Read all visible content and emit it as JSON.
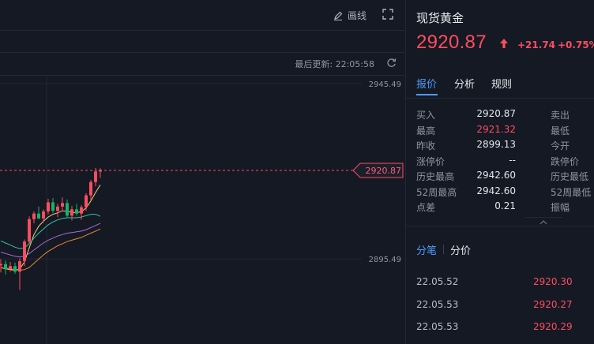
{
  "toolbar": {
    "draw_label": "画线",
    "draw_icon": "pen-icon",
    "fullscreen_icon": "fullscreen-icon"
  },
  "chart": {
    "last_update_label": "最后更新: 22:05:58",
    "refresh_icon": "refresh-icon",
    "axis_labels": [
      "2945.49",
      "2895.49"
    ],
    "current_price_tag": "2920.87"
  },
  "chart_data": {
    "type": "candlestick",
    "title": "",
    "y_ticks": [
      2945.49,
      2895.49
    ],
    "last_price": 2920.87,
    "colors": {
      "up": "#ff4d60",
      "down": "#17b26a"
    },
    "candles": [
      {
        "o": 2893.6,
        "h": 2895.4,
        "l": 2891.6,
        "c": 2894.0
      },
      {
        "o": 2894.0,
        "h": 2895.0,
        "l": 2891.0,
        "c": 2892.5
      },
      {
        "o": 2892.5,
        "h": 2894.6,
        "l": 2891.8,
        "c": 2893.4
      },
      {
        "o": 2893.4,
        "h": 2894.4,
        "l": 2891.2,
        "c": 2891.8
      },
      {
        "o": 2891.8,
        "h": 2895.6,
        "l": 2886.6,
        "c": 2894.8
      },
      {
        "o": 2894.8,
        "h": 2901.0,
        "l": 2893.4,
        "c": 2900.4
      },
      {
        "o": 2900.4,
        "h": 2907.6,
        "l": 2899.6,
        "c": 2906.8
      },
      {
        "o": 2906.8,
        "h": 2909.0,
        "l": 2905.6,
        "c": 2908.4
      },
      {
        "o": 2908.4,
        "h": 2910.4,
        "l": 2906.8,
        "c": 2907.0
      },
      {
        "o": 2907.0,
        "h": 2909.6,
        "l": 2905.8,
        "c": 2909.0
      },
      {
        "o": 2909.0,
        "h": 2912.6,
        "l": 2908.2,
        "c": 2911.6
      },
      {
        "o": 2911.6,
        "h": 2912.8,
        "l": 2908.6,
        "c": 2909.2
      },
      {
        "o": 2909.2,
        "h": 2911.2,
        "l": 2907.4,
        "c": 2910.4
      },
      {
        "o": 2910.4,
        "h": 2913.0,
        "l": 2909.0,
        "c": 2911.4
      },
      {
        "o": 2911.4,
        "h": 2912.4,
        "l": 2907.2,
        "c": 2907.8
      },
      {
        "o": 2907.8,
        "h": 2910.6,
        "l": 2906.4,
        "c": 2909.6
      },
      {
        "o": 2909.6,
        "h": 2911.2,
        "l": 2907.8,
        "c": 2908.4
      },
      {
        "o": 2908.4,
        "h": 2910.8,
        "l": 2906.6,
        "c": 2910.2
      },
      {
        "o": 2910.2,
        "h": 2914.2,
        "l": 2909.2,
        "c": 2913.6
      },
      {
        "o": 2913.6,
        "h": 2918.0,
        "l": 2912.2,
        "c": 2917.4
      },
      {
        "o": 2917.4,
        "h": 2921.4,
        "l": 2916.2,
        "c": 2920.4
      },
      {
        "o": 2920.4,
        "h": 2921.3,
        "l": 2918.6,
        "c": 2920.87
      }
    ],
    "ma_lines": [
      {
        "color": "#e8d27a",
        "values": [
          2893.0,
          2892.6,
          2892.4,
          2892.2,
          2892.6,
          2894.6,
          2898.6,
          2902.4,
          2904.8,
          2906.2,
          2907.4,
          2908.2,
          2908.6,
          2909.2,
          2909.0,
          2908.8,
          2908.6,
          2909.0,
          2910.0,
          2912.0,
          2914.4,
          2916.6
        ]
      },
      {
        "color": "#2fc6a8",
        "values": [
          2900.6,
          2900.0,
          2899.4,
          2898.8,
          2898.4,
          2898.6,
          2899.8,
          2901.4,
          2902.8,
          2904.0,
          2905.2,
          2906.0,
          2906.6,
          2907.0,
          2907.2,
          2907.2,
          2907.2,
          2907.4,
          2907.8,
          2908.2,
          2908.2,
          2907.6
        ]
      },
      {
        "color": "#a96ae0",
        "values": [
          2897.4,
          2897.0,
          2896.6,
          2896.2,
          2896.0,
          2896.2,
          2897.0,
          2898.0,
          2899.0,
          2900.0,
          2900.8,
          2901.4,
          2902.0,
          2902.4,
          2902.8,
          2903.0,
          2903.2,
          2903.4,
          2903.8,
          2904.4,
          2905.0,
          2905.6
        ]
      },
      {
        "color": "#e4883a",
        "values": [
          2893.0,
          2892.8,
          2892.6,
          2892.4,
          2892.2,
          2892.4,
          2893.0,
          2894.2,
          2895.4,
          2896.6,
          2897.6,
          2898.4,
          2899.2,
          2899.8,
          2900.4,
          2900.8,
          2901.2,
          2901.6,
          2902.2,
          2902.8,
          2903.4,
          2904.0
        ]
      }
    ]
  },
  "quote": {
    "name": "现货黄金",
    "price": "2920.87",
    "change": "+21.74",
    "change_pct": "+0.75%",
    "arrow_icon": "arrow-up-icon"
  },
  "tabs": [
    "报价",
    "分析",
    "规则"
  ],
  "stats": [
    {
      "k1": "买入",
      "v1": "2920.87",
      "red": false,
      "k2": "卖出"
    },
    {
      "k1": "最高",
      "v1": "2921.32",
      "red": true,
      "k2": "最低"
    },
    {
      "k1": "昨收",
      "v1": "2899.13",
      "red": false,
      "k2": "今开"
    },
    {
      "k1": "涨停价",
      "v1": "--",
      "red": false,
      "k2": "跌停价"
    },
    {
      "k1": "历史最高",
      "v1": "2942.60",
      "red": false,
      "k2": "历史最低"
    },
    {
      "k1": "52周最高",
      "v1": "2942.60",
      "red": false,
      "k2": "52周最低"
    },
    {
      "k1": "点差",
      "v1": "0.21",
      "red": false,
      "k2": "振幅"
    }
  ],
  "trades_tabs": [
    "分笔",
    "分价"
  ],
  "trades": [
    {
      "time": "22.05.52",
      "price": "2920.30"
    },
    {
      "time": "22.05.53",
      "price": "2920.27"
    },
    {
      "time": "22.05.53",
      "price": "2920.29"
    }
  ]
}
